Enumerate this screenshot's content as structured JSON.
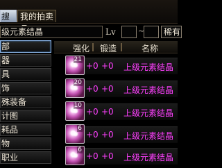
{
  "tabs": {
    "search_label": "搜索",
    "my_auction_label": "我的拍卖品"
  },
  "search": {
    "query": "级元素结晶",
    "level_label": "Lv",
    "level_min": "",
    "level_sep": "~",
    "level_max": "",
    "rarity_label": "稀有"
  },
  "categories": [
    "部",
    "器",
    "具",
    "饰",
    "殊装备",
    "计图",
    "耗品",
    "物",
    "职业"
  ],
  "columns": {
    "enhance": "强化",
    "forge": "锻造",
    "name": "名称"
  },
  "rows": [
    {
      "qty": "21",
      "enhance": "+0",
      "forge": "+0",
      "name": "上级元素结晶"
    },
    {
      "qty": "20",
      "enhance": "+0",
      "forge": "+0",
      "name": "上级元素结晶"
    },
    {
      "qty": "10",
      "enhance": "+0",
      "forge": "+0",
      "name": "上级元素结晶"
    },
    {
      "qty": "6",
      "enhance": "+0",
      "forge": "+0",
      "name": "上级元素结晶"
    },
    {
      "qty": "6",
      "enhance": "+0",
      "forge": "+0",
      "name": "上级元素结晶"
    }
  ],
  "colors": {
    "item_name": "#ff40ff",
    "selection_border": "#8ab4e8"
  }
}
